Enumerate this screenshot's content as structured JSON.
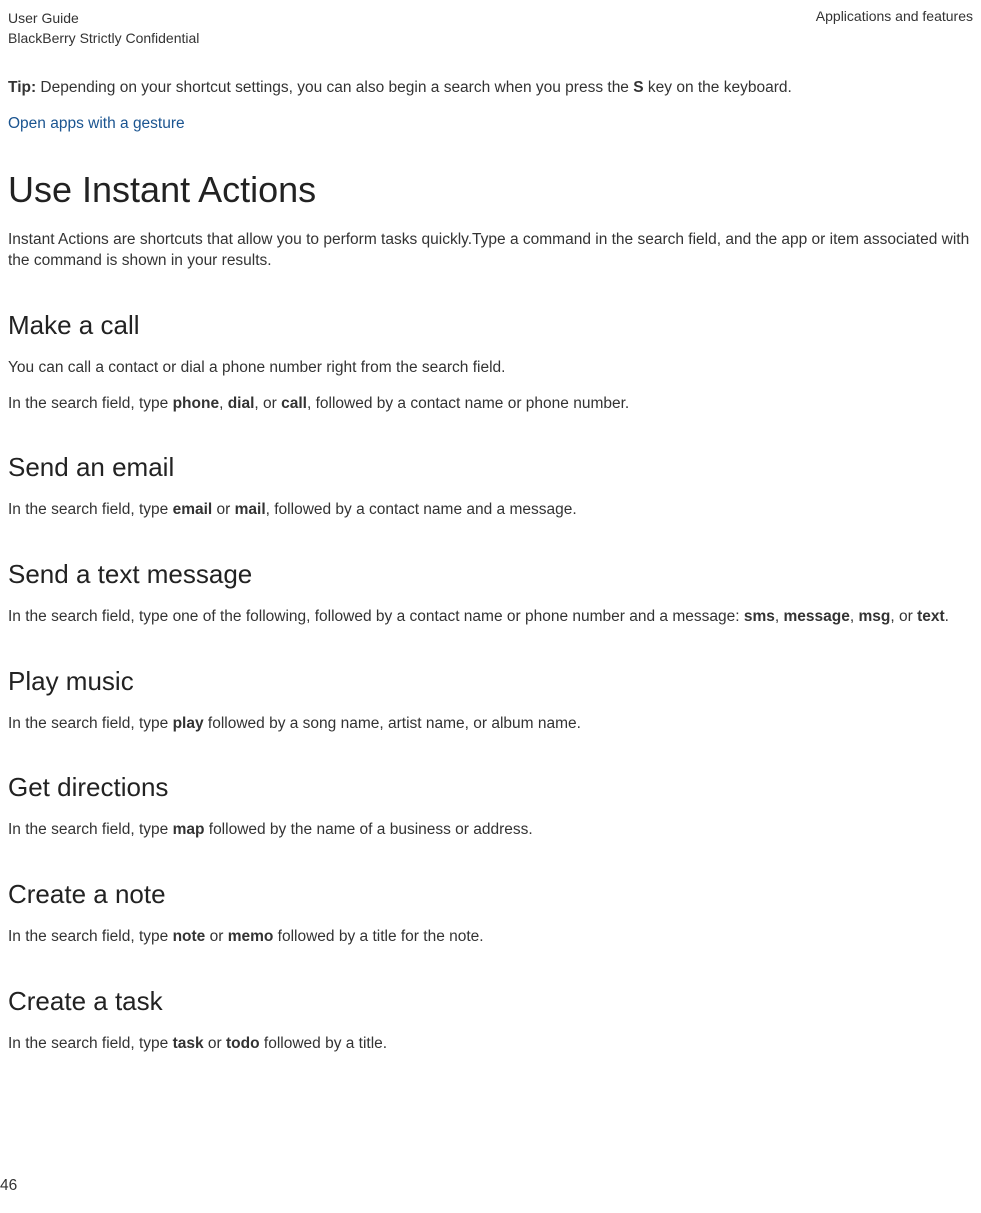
{
  "header": {
    "left_line1": "User Guide",
    "left_line2": "BlackBerry Strictly Confidential",
    "right": "Applications and features"
  },
  "tip": {
    "label": "Tip:",
    "text_before": " Depending on your shortcut settings, you can also begin a search when you press the ",
    "key": "S",
    "text_after": " key on the keyboard."
  },
  "link_text": "Open apps with a gesture",
  "h1": "Use Instant Actions",
  "intro": "Instant Actions are shortcuts that allow you to perform tasks quickly.Type a command in the search field, and the app or item associated with the command is shown in your results.",
  "sections": {
    "make_call": {
      "title": "Make a call",
      "p1": "You can call a contact or dial a phone number right from the search field.",
      "p2_before": "In the search field, type ",
      "p2_b1": "phone",
      "p2_mid1": ", ",
      "p2_b2": "dial",
      "p2_mid2": ", or ",
      "p2_b3": "call",
      "p2_after": ", followed by a contact name or phone number."
    },
    "send_email": {
      "title": "Send an email",
      "p1_before": "In the search field, type ",
      "p1_b1": "email",
      "p1_mid": " or ",
      "p1_b2": "mail",
      "p1_after": ", followed by a contact name and a message."
    },
    "send_text": {
      "title": "Send a text message",
      "p1_before": "In the search field, type one of the following, followed by a contact name or phone number and a message: ",
      "p1_b1": "sms",
      "p1_mid1": ", ",
      "p1_b2": "message",
      "p1_mid2": ", ",
      "p1_b3": "msg",
      "p1_mid3": ", or ",
      "p1_b4": "text",
      "p1_after": "."
    },
    "play_music": {
      "title": "Play music",
      "p1_before": "In the search field, type ",
      "p1_b1": "play",
      "p1_after": " followed by a song name, artist name, or album name."
    },
    "get_directions": {
      "title": "Get directions",
      "p1_before": "In the search field, type ",
      "p1_b1": "map",
      "p1_after": " followed by the name of a business or address."
    },
    "create_note": {
      "title": "Create a note",
      "p1_before": "In the search field, type ",
      "p1_b1": "note",
      "p1_mid": " or ",
      "p1_b2": "memo",
      "p1_after": " followed by a title for the note."
    },
    "create_task": {
      "title": "Create a task",
      "p1_before": "In the search field, type ",
      "p1_b1": "task",
      "p1_mid": " or ",
      "p1_b2": "todo",
      "p1_after": " followed by a title."
    }
  },
  "page_number": "46"
}
